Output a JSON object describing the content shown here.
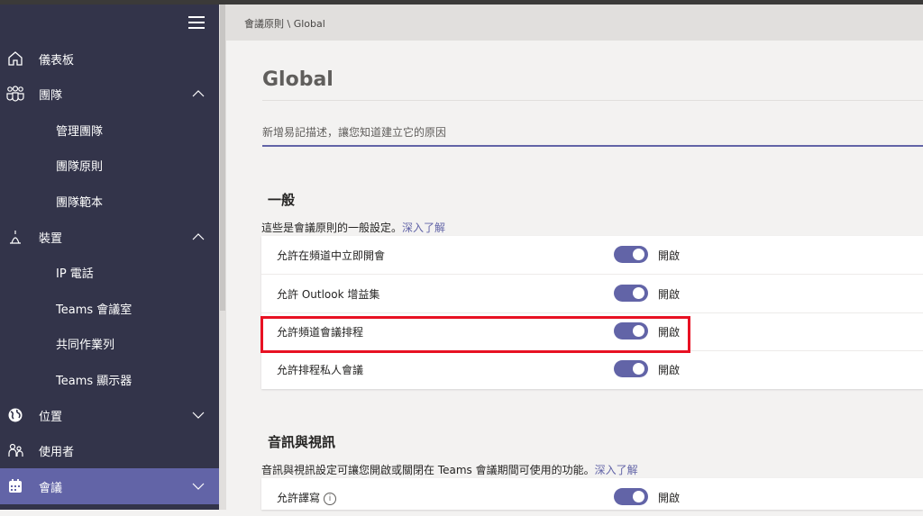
{
  "sidebar": {
    "items": [
      {
        "label": "儀表板",
        "icon": "home-icon"
      },
      {
        "label": "團隊",
        "icon": "teams-icon",
        "expanded": true
      },
      {
        "label": "管理團隊"
      },
      {
        "label": "團隊原則"
      },
      {
        "label": "團隊範本"
      },
      {
        "label": "裝置",
        "icon": "devices-icon",
        "expanded": true
      },
      {
        "label": "IP 電話"
      },
      {
        "label": "Teams 會議室"
      },
      {
        "label": "共同作業列"
      },
      {
        "label": "Teams 顯示器"
      },
      {
        "label": "位置",
        "icon": "globe-icon",
        "expanded": false
      },
      {
        "label": "使用者",
        "icon": "users-icon"
      },
      {
        "label": "會議",
        "icon": "calendar-icon",
        "expanded": false,
        "active": true
      }
    ]
  },
  "breadcrumb": "會議原則 \\ Global",
  "page": {
    "title": "Global",
    "description_placeholder": "新增易記描述，讓您知道建立它的原因"
  },
  "general": {
    "title": "一般",
    "desc": "這些是會議原則的一般設定。",
    "learn_more": "深入了解",
    "rows": [
      {
        "label": "允許在頻道中立即開會",
        "state": "開啟"
      },
      {
        "label": "允許 Outlook 增益集",
        "state": "開啟"
      },
      {
        "label": "允許頻道會議排程",
        "state": "開啟"
      },
      {
        "label": "允許排程私人會議",
        "state": "開啟"
      }
    ]
  },
  "av": {
    "title": "音訊與視訊",
    "desc": "音訊與視訊設定可讓您開啟或關閉在 Teams 會議期間可使用的功能。",
    "learn_more": "深入了解",
    "rows": [
      {
        "label": "允許譯寫",
        "state": "開啟",
        "info_icon": "info-icon"
      }
    ]
  },
  "colors": {
    "accent": "#6264a7",
    "sidebar": "#33344a",
    "highlight": "#e81123"
  }
}
